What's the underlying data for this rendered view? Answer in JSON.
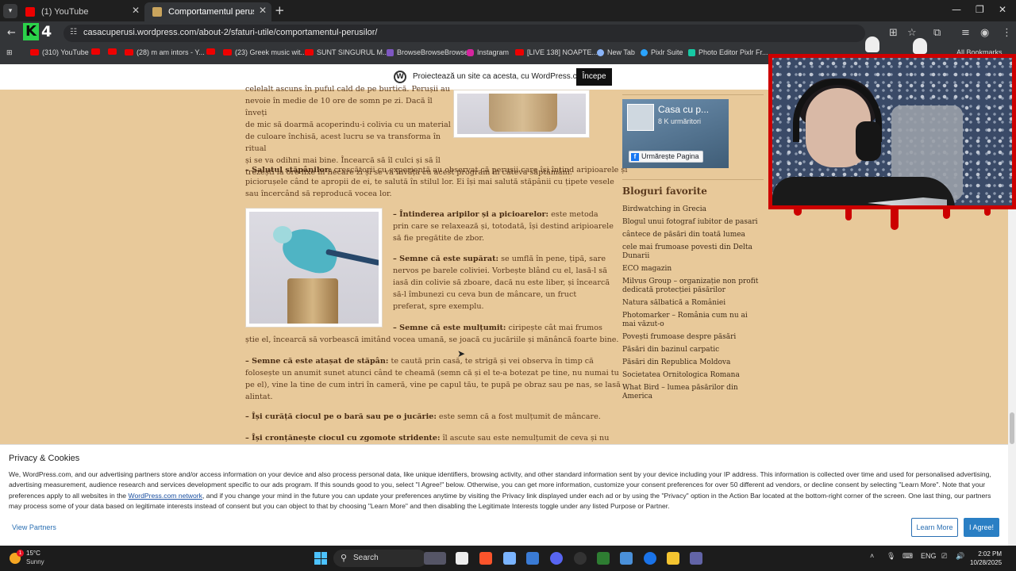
{
  "browser": {
    "tabs": [
      {
        "title": "(1) YouTube",
        "active": false
      },
      {
        "title": "Comportamentul perușilor | Ca",
        "active": true
      }
    ],
    "url": "casacuperusi.wordpress.com/about-2/sfaturi-utile/comportamentul-perusilor/",
    "bookmarks": [
      "(310) YouTube",
      "(28) m am intors - Y...",
      "(23) Greek music wit...",
      "SUNT SINGURUL M...",
      "BrowseBrowseBrowse",
      "Instagram",
      "[LIVE 138] NOAPTE...",
      "New Tab",
      "Pixlr Suite",
      "Photo Editor Pixlr Fr...",
      "All Bookmarks"
    ]
  },
  "wp_bar": {
    "text": "Proiectează un site ca acesta, cu WordPress.com",
    "button": "Începe"
  },
  "article": {
    "p1_lines": [
      "celelalt ascuns în puful cald de pe burtică. Perușii au",
      "nevoie în medie de 10 ore de somn pe zi. Dacă îl înveți",
      "de mic să doarmă acoperindu-i colivia cu un material",
      "de culoare închisă, acest lucru se va transforma în ritual",
      "și se va odihni mai bine. Încearcă să îl culci și să îl",
      "trezești la ore fixe în fiecare zi și se va învăța cu acest program în câteva săptămâni."
    ],
    "salutul_title": "– Salutul stăpânilor:",
    "salutul_lines": [
      " crescătorii cu experiență au observat că perușii care își întind aripioarele și",
      "piciorușele când te apropii de ei, te salută în stilul lor. Ei își mai salută stăpânii cu țipete vesele",
      "sau încercând să reproducă vocea lor."
    ],
    "intinderea_title": "– Întinderea aripilor și a picioarelor:",
    "intinderea_lines": [
      " este metoda",
      "prin care se relaxează și, totodată, își destind aripioarele",
      "să fie pregătite de zbor."
    ],
    "suparat_title": "– Semne că este supărat:",
    "suparat_lines": [
      " se umflă în pene, țipă, sare",
      "nervos pe barele coliviei. Vorbește blând cu el, lasă-l să",
      "iasă din colivie să zboare, dacă nu este liber, și încearcă",
      "să-l îmbunezi cu ceva bun de mâncare, un fruct",
      "preferat, spre exemplu."
    ],
    "multumit_title": "– Semne că este mulțumit:",
    "multumit_lines": [
      " ciripește cât mai frumos",
      "știe el, încearcă să vorbească imitând vocea umană, se joacă cu jucăriile și mănâncă foarte bine."
    ],
    "atasat_title": "– Semne că este atașat de stăpân:",
    "atasat_lines": [
      " te caută prin casă, te strigă și vei observa în timp că",
      "folosește un anumit sunet atunci când te cheamă (semn că și el te-a botezat pe tine, nu numai tu",
      "pe el), vine la tine de cum intri în cameră, vine pe capul tău, te pupă pe obraz sau pe nas, se lasă",
      "alintat."
    ],
    "curata_title": "– Își curăță ciocul pe o bară sau pe o jucărie:",
    "curata_text": " este semn că a fost mulțumit de mâncare.",
    "crontaneste_title": "– Își cronțănește ciocul cu zgomote stridente:",
    "crontaneste_text": " îl ascute sau este nemulțumit de ceva și nu"
  },
  "sidebar": {
    "fb": {
      "name": "Casa cu p...",
      "followers": "8 K urmăritori",
      "follow": "Urmărește Pagina"
    },
    "blog_title": "Bloguri favorite",
    "blogs": [
      "Birdwatching in Grecia",
      "Blogul unui fotograf iubitor de pasari",
      "cântece de păsări din toată lumea",
      "cele mai frumoase povesti din Delta Dunarii",
      "ECO magazin",
      "Milvus Group – organizație non profit dedicată protecției păsărilor",
      "Natura sălbatică a României",
      "Photomarker – România cum nu ai mai văzut-o",
      "Povești frumoase despre păsări",
      "Păsări din bazinul carpatic",
      "Păsări din Republica Moldova",
      "Societatea Ornitologica Romana",
      "What Bird – lumea păsărilor din America"
    ]
  },
  "privacy": {
    "title": "Privacy & Cookies",
    "text_before_link": "We, WordPress.com, and our advertising partners store and/or access information on your device and also process personal data, like unique identifiers, browsing activity, and other standard information sent by your device including your IP address. This information is collected over time and used for personalised advertising, advertising measurement, audience research and services development specific to our ads program. If this sounds good to you, select \"I Agree!\" below. Otherwise, you can get more information, customize your consent preferences for over 50 different ad vendors, or decline consent by selecting \"Learn More\". Note that your preferences apply to all websites in the ",
    "link": "WordPress.com network",
    "text_after_link": ", and if you change your mind in the future you can update your preferences anytime by visiting the Privacy link displayed under each ad or by using the \"Privacy\" option in the Action Bar located at the bottom-right corner of the screen. One last thing, our partners may process some of your data based on legitimate interests instead of consent but you can object to that by choosing \"Learn More\" and then disabling the Legitimate Interests toggle under any listed Purpose or Partner.",
    "view_partners": "View Partners",
    "learn_more": "Learn More",
    "agree": "I Agree!"
  },
  "taskbar": {
    "temp": "15°C",
    "condition": "Sunny",
    "weather_badge": "1",
    "search": "Search",
    "lang": "ENG",
    "time": "2:02 PM",
    "date": "10/28/2025"
  }
}
